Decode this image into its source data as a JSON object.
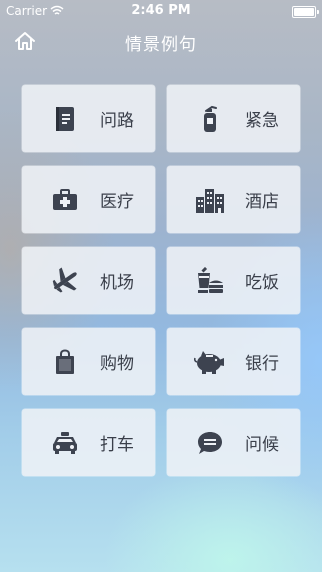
{
  "status_bar": {
    "carrier": "Carrier",
    "time": "2:46 PM"
  },
  "nav": {
    "title": "情景例句",
    "home_icon": "home-icon"
  },
  "colors": {
    "icon": "#3d4350",
    "label": "#3a3f4a",
    "tile_bg": "#eef1f6"
  },
  "tiles": [
    {
      "label": "问路",
      "icon": "directions-book-icon"
    },
    {
      "label": "紧急",
      "icon": "fire-extinguisher-icon"
    },
    {
      "label": "医疗",
      "icon": "first-aid-kit-icon"
    },
    {
      "label": "酒店",
      "icon": "buildings-icon"
    },
    {
      "label": "机场",
      "icon": "airplane-icon"
    },
    {
      "label": "吃饭",
      "icon": "fast-food-icon"
    },
    {
      "label": "购物",
      "icon": "shopping-bag-icon"
    },
    {
      "label": "银行",
      "icon": "piggy-bank-icon"
    },
    {
      "label": "打车",
      "icon": "taxi-icon"
    },
    {
      "label": "问候",
      "icon": "chat-bubble-icon"
    }
  ]
}
